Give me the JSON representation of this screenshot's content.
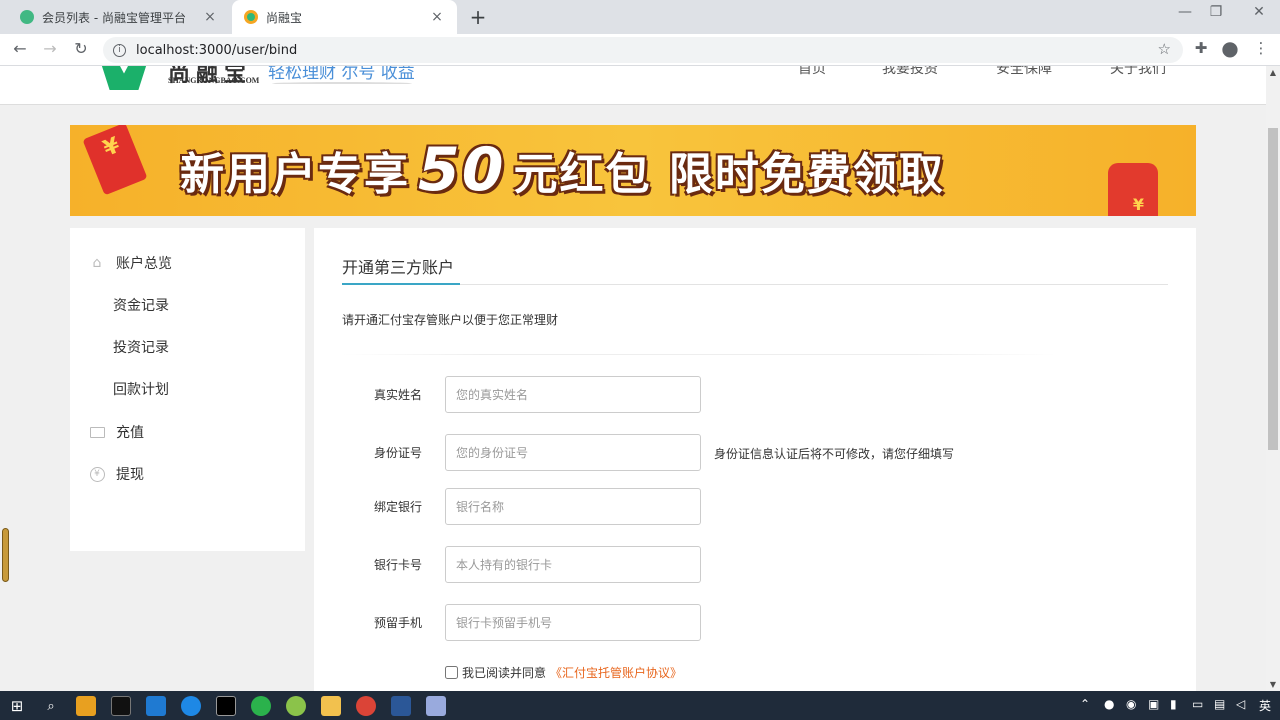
{
  "browser": {
    "tabs": [
      {
        "title": "会员列表 - 尚融宝管理平台",
        "active": false
      },
      {
        "title": "尚融宝",
        "active": true
      }
    ],
    "url": "localhost:3000/user/bind",
    "new_tab": "+",
    "close": "×",
    "minimize": "—",
    "maximize": "❐",
    "window_close": "✕"
  },
  "site": {
    "logo_cn": "尚融宝",
    "logo_en": "SHANGRONGBAO.COM",
    "slogan": "轻松理财 尔号 收益",
    "nav": [
      "首页",
      "我要投资",
      "安全保障",
      "关于我们"
    ]
  },
  "banner": {
    "text_a": "新用户专享",
    "text_big": "50",
    "text_b": "元红包 限时免费领取",
    "yen": "¥"
  },
  "sidebar": {
    "items": [
      {
        "label": "账户总览",
        "icon": "home-icon"
      },
      {
        "label": "资金记录",
        "icon": ""
      },
      {
        "label": "投资记录",
        "icon": ""
      },
      {
        "label": "回款计划",
        "icon": ""
      },
      {
        "label": "充值",
        "icon": "folder-icon"
      },
      {
        "label": "提现",
        "icon": "yen-icon"
      }
    ]
  },
  "main": {
    "title": "开通第三方账户",
    "intro": "请开通汇付宝存管账户以便于您正常理财",
    "fields": [
      {
        "label": "真实姓名",
        "placeholder": "您的真实姓名",
        "value": ""
      },
      {
        "label": "身份证号",
        "placeholder": "您的身份证号",
        "value": "",
        "hint": "身份证信息认证后将不可修改，请您仔细填写"
      },
      {
        "label": "绑定银行",
        "placeholder": "银行名称",
        "value": ""
      },
      {
        "label": "银行卡号",
        "placeholder": "本人持有的银行卡",
        "value": ""
      },
      {
        "label": "预留手机",
        "placeholder": "银行卡预留手机号",
        "value": ""
      }
    ],
    "agree_text": "我已阅读并同意",
    "agree_link": "《汇付宝托管账户协议》"
  },
  "taskbar": {
    "tray_lang": "英"
  },
  "colors": {
    "accent": "#3aa6c6",
    "link": "#e8671f",
    "banner": "#f6b12a"
  }
}
